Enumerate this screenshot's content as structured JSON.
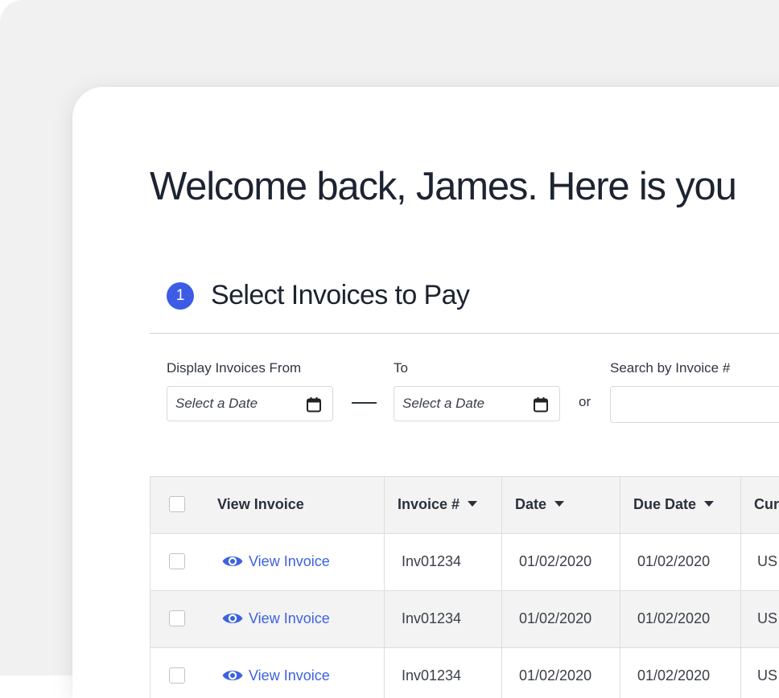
{
  "page": {
    "title": "Welcome back, James. Here is you"
  },
  "step": {
    "number": "1",
    "title": "Select Invoices to Pay"
  },
  "filters": {
    "from_label": "Display Invoices From",
    "from_placeholder": "Select a Date",
    "to_label": "To",
    "to_placeholder": "Select a Date",
    "or_text": "or",
    "search_label": "Search by Invoice #",
    "search_value": ""
  },
  "icons": {
    "calendar": "calendar-icon",
    "sort": "caret-down-icon",
    "view": "eye-icon"
  },
  "colors": {
    "accent": "#3c5ce6",
    "link": "#3d62e0",
    "header_bg": "#f3f3f4"
  },
  "table": {
    "headers": {
      "view": "View Invoice",
      "invoice": "Invoice #",
      "date": "Date",
      "due_date": "Due Date",
      "currency": "Cur"
    },
    "rows": [
      {
        "view_label": "View Invoice",
        "invoice": "Inv01234",
        "date": "01/02/2020",
        "due_date": "01/02/2020",
        "currency": "US"
      },
      {
        "view_label": "View Invoice",
        "invoice": "Inv01234",
        "date": "01/02/2020",
        "due_date": "01/02/2020",
        "currency": "US"
      },
      {
        "view_label": "View Invoice",
        "invoice": "Inv01234",
        "date": "01/02/2020",
        "due_date": "01/02/2020",
        "currency": "US"
      }
    ]
  }
}
